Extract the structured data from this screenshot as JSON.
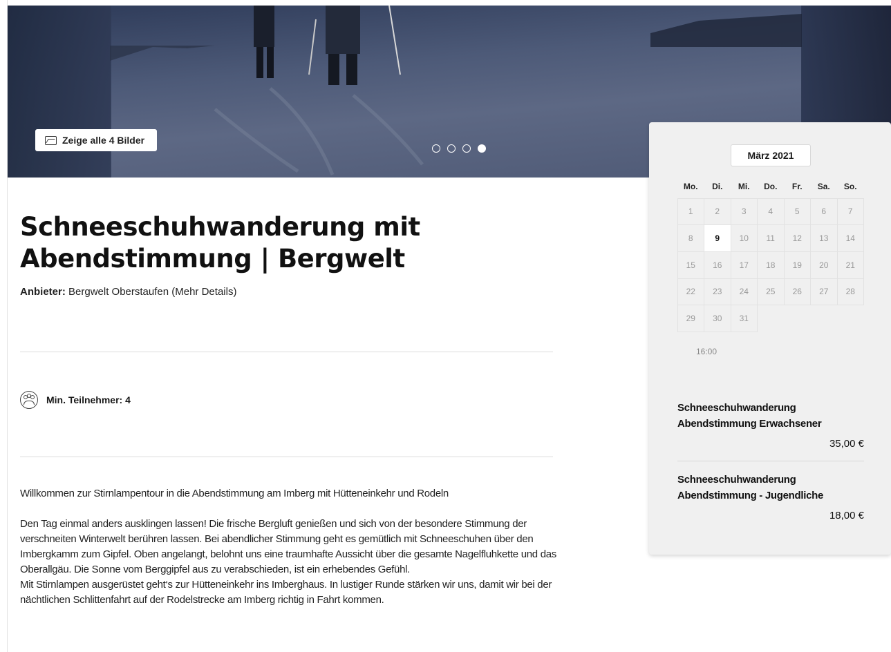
{
  "hero": {
    "show_all_label": "Zeige alle 4 Bilder",
    "icon": "image-icon",
    "slide_count": 4,
    "active_slide": 4
  },
  "event": {
    "title": "Schneeschuhwanderung mit Abendstimmung | Bergwelt",
    "provider_label": "Anbieter:",
    "provider_name": "Bergwelt Oberstaufen (Mehr Details)",
    "min_participants": "Min. Teilnehmer: 4",
    "participants_icon": "group-icon"
  },
  "description": {
    "intro": "Willkommen zur Stirnlampentour in die Abendstimmung am Imberg mit Hütteneinkehr und Rodeln",
    "p1": "Den Tag einmal anders ausklingen lassen! Die frische Bergluft genießen und sich von der besondere Stimmung  der verschneiten Winterwelt berühren lassen. Bei abendlicher Stimmung geht es gemütlich mit Schneeschuhen über den Imbergkamm zum Gipfel.  Oben angelangt, belohnt uns eine traumhafte Aussicht über die gesamte Nagelfluhkette und das Oberallgäu. Die Sonne vom Berggipfel aus zu verabschieden, ist ein erhebendes Gefühl.",
    "p2": "Mit Stirnlampen ausgerüstet geht‘s zur Hütteneinkehr ins Imberghaus. In lustiger Runde stärken wir uns, damit wir bei der nächtlichen Schlittenfahrt auf der Rodelstrecke am Imberg richtig in Fahrt kommen."
  },
  "calendar": {
    "month": "März 2021",
    "weekdays": [
      "Mo.",
      "Di.",
      "Mi.",
      "Do.",
      "Fr.",
      "Sa.",
      "So."
    ],
    "days": [
      "1",
      "2",
      "3",
      "4",
      "5",
      "6",
      "7",
      "8",
      "9",
      "10",
      "11",
      "12",
      "13",
      "14",
      "15",
      "16",
      "17",
      "18",
      "19",
      "20",
      "21",
      "22",
      "23",
      "24",
      "25",
      "26",
      "27",
      "28",
      "29",
      "30",
      "31"
    ],
    "selected_day": "9",
    "time": "16:00"
  },
  "offers": [
    {
      "name": "Schneeschuhwanderung Abendstimmung Erwachsener",
      "price": "35,00 €"
    },
    {
      "name": "Schneeschuhwanderung Abendstimmung - Jugendliche",
      "price": "18,00 €"
    }
  ]
}
